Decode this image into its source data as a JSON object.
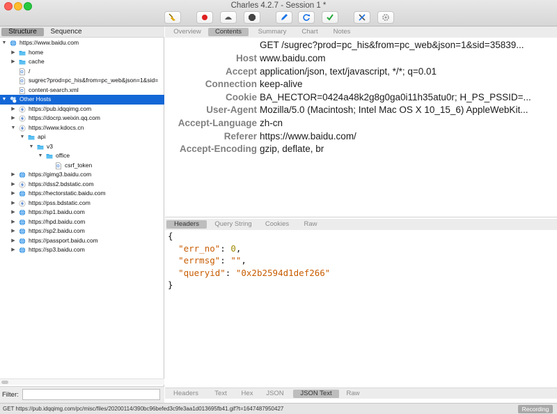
{
  "window": {
    "title": "Charles 4.2.7 - Session 1 *"
  },
  "toolbar": {
    "buttons": [
      {
        "name": "broom-icon",
        "color": "#e0a700"
      },
      {
        "name": "record-icon",
        "color": "#e02020"
      },
      {
        "name": "throttle-icon",
        "color": "#444444"
      },
      {
        "name": "breakpoint-icon",
        "color": "#444444"
      },
      {
        "name": "compose-pen-icon",
        "color": "#1a73e8"
      },
      {
        "name": "repeat-icon",
        "color": "#1a73e8"
      },
      {
        "name": "validate-check-icon",
        "color": "#22a83a"
      },
      {
        "name": "tools-icon",
        "color": "#1a73e8"
      },
      {
        "name": "settings-gear-icon",
        "color": "#888888"
      }
    ]
  },
  "left_pane": {
    "segments": [
      "Structure",
      "Sequence"
    ],
    "active_segment": "Structure",
    "tree": [
      {
        "label": "https://www.baidu.com",
        "indent": 0,
        "disclosure": "open",
        "icon": "globe-icon"
      },
      {
        "label": "home",
        "indent": 1,
        "disclosure": "closed",
        "icon": "folder-icon"
      },
      {
        "label": "cache",
        "indent": 1,
        "disclosure": "closed",
        "icon": "folder-icon"
      },
      {
        "label": "/",
        "indent": 1,
        "disclosure": "none",
        "icon": "file-icon"
      },
      {
        "label": "sugrec?prod=pc_his&from=pc_web&json=1&sid=",
        "indent": 1,
        "disclosure": "none",
        "icon": "file-icon"
      },
      {
        "label": "content-search.xml",
        "indent": 1,
        "disclosure": "none",
        "icon": "file-icon"
      },
      {
        "label": "Other Hosts",
        "indent": 0,
        "disclosure": "open",
        "icon": "hosts-icon",
        "selected": true
      },
      {
        "label": "https://pub.idqqimg.com",
        "indent": 1,
        "disclosure": "closed",
        "icon": "lightning-icon"
      },
      {
        "label": "https://docrp.weixin.qq.com",
        "indent": 1,
        "disclosure": "closed",
        "icon": "lightning-icon"
      },
      {
        "label": "https://www.kdocs.cn",
        "indent": 1,
        "disclosure": "open",
        "icon": "lightning-icon"
      },
      {
        "label": "api",
        "indent": 2,
        "disclosure": "open",
        "icon": "folder-icon"
      },
      {
        "label": "v3",
        "indent": 3,
        "disclosure": "open",
        "icon": "folder-icon"
      },
      {
        "label": "office",
        "indent": 4,
        "disclosure": "open",
        "icon": "folder-icon"
      },
      {
        "label": "csrf_token",
        "indent": 5,
        "disclosure": "none",
        "icon": "file-icon"
      },
      {
        "label": "https://gimg3.baidu.com",
        "indent": 1,
        "disclosure": "closed",
        "icon": "globe-icon"
      },
      {
        "label": "https://dss2.bdstatic.com",
        "indent": 1,
        "disclosure": "closed",
        "icon": "lightning-icon"
      },
      {
        "label": "https://hectorstatic.baidu.com",
        "indent": 1,
        "disclosure": "closed",
        "icon": "globe-icon"
      },
      {
        "label": "https://pss.bdstatic.com",
        "indent": 1,
        "disclosure": "closed",
        "icon": "lightning-icon"
      },
      {
        "label": "https://sp1.baidu.com",
        "indent": 1,
        "disclosure": "closed",
        "icon": "globe-icon"
      },
      {
        "label": "https://hpd.baidu.com",
        "indent": 1,
        "disclosure": "closed",
        "icon": "globe-icon"
      },
      {
        "label": "https://sp2.baidu.com",
        "indent": 1,
        "disclosure": "closed",
        "icon": "globe-icon"
      },
      {
        "label": "https://passport.baidu.com",
        "indent": 1,
        "disclosure": "closed",
        "icon": "globe-icon"
      },
      {
        "label": "https://sp3.baidu.com",
        "indent": 1,
        "disclosure": "closed",
        "icon": "globe-icon"
      }
    ],
    "filter_label": "Filter:",
    "filter_value": ""
  },
  "right_pane": {
    "top_tabs": [
      "Overview",
      "Contents",
      "Summary",
      "Chart",
      "Notes"
    ],
    "top_active": "Contents",
    "request_line": "GET /sugrec?prod=pc_his&from=pc_web&json=1&sid=35839...",
    "headers": [
      {
        "key": "Host",
        "value": "www.baidu.com"
      },
      {
        "key": "Accept",
        "value": "application/json, text/javascript, */*; q=0.01"
      },
      {
        "key": "Connection",
        "value": "keep-alive"
      },
      {
        "key": "Cookie",
        "value": "BA_HECTOR=0424a48k2g8g0ga0i11h35atu0r; H_PS_PSSID=..."
      },
      {
        "key": "User-Agent",
        "value": "Mozilla/5.0 (Macintosh; Intel Mac OS X 10_15_6) AppleWebKit..."
      },
      {
        "key": "Accept-Language",
        "value": "zh-cn"
      },
      {
        "key": "Referer",
        "value": "https://www.baidu.com/"
      },
      {
        "key": "Accept-Encoding",
        "value": "gzip, deflate, br"
      }
    ],
    "request_tabs": [
      "Headers",
      "Query String",
      "Cookies",
      "Raw"
    ],
    "request_active": "Headers",
    "json": {
      "open_brace": "{",
      "close_brace": "}",
      "entries": [
        {
          "key": "\"err_no\"",
          "value": "0",
          "type": "number",
          "trail": ","
        },
        {
          "key": "\"errmsg\"",
          "value": "\"\"",
          "type": "string",
          "trail": ","
        },
        {
          "key": "\"queryid\"",
          "value": "\"0x2b2594d1def266\"",
          "type": "string",
          "trail": ""
        }
      ]
    },
    "response_tabs": [
      "Headers",
      "Text",
      "Hex",
      "JSON",
      "JSON Text",
      "Raw"
    ],
    "response_active": "JSON Text"
  },
  "status_bar": {
    "text": "GET https://pub.idqqimg.com/pc/misc/files/20200114/390bc96befed3c9fe3aa1d013695fb41.gif?t=1647487950427",
    "recording_label": "Recording"
  }
}
